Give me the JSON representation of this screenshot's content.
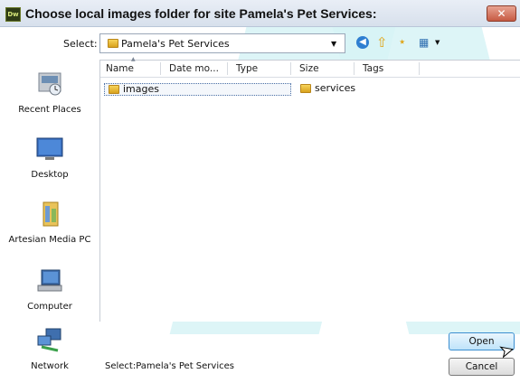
{
  "window": {
    "app_icon_label": "Dw",
    "title": "Choose local images folder for site Pamela's Pet Services:",
    "close_glyph": "✕"
  },
  "toolbar": {
    "select_label": "Select:",
    "current_folder": "Pamela's Pet Services",
    "icons": [
      "back-icon",
      "up-folder-icon",
      "new-folder-icon",
      "views-menu-icon"
    ]
  },
  "places": [
    {
      "label": "Recent Places",
      "icon": "recent-places-icon"
    },
    {
      "label": "Desktop",
      "icon": "desktop-icon"
    },
    {
      "label": "Artesian Media PC",
      "icon": "user-folder-icon"
    },
    {
      "label": "Computer",
      "icon": "computer-icon"
    },
    {
      "label": "Network",
      "icon": "network-icon"
    }
  ],
  "columns": [
    "Name",
    "Date mo...",
    "Type",
    "Size",
    "Tags"
  ],
  "items": [
    {
      "name": "images",
      "selected": true
    },
    {
      "name": "services",
      "selected": false
    }
  ],
  "status": {
    "text": "Select:Pamela's Pet Services"
  },
  "buttons": {
    "open": "Open",
    "cancel": "Cancel"
  },
  "colors": {
    "title_bar": "#dde5f0",
    "watermark": "#d7f3f6",
    "open_button_border": "#3c8fd1"
  }
}
